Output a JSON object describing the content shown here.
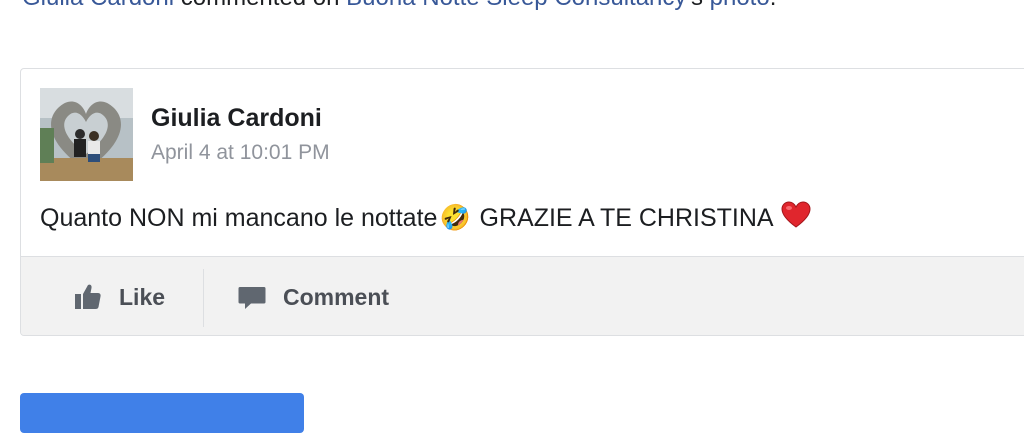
{
  "header": {
    "author_link": "Giulia Cardoni",
    "action_text": " commented on ",
    "page_link": "Buona Notte Sleep Consultancy",
    "possessive": "'s ",
    "photo_link": "photo",
    "period": "."
  },
  "comment": {
    "author": "Giulia Cardoni",
    "timestamp": "April 4 at 10:01 PM",
    "text_part1": "Quanto NON mi mancano le nottate",
    "emoji1": "🤣",
    "text_part2": " GRAZIE A TE CHRISTINA ",
    "emoji2": "❤️"
  },
  "actions": {
    "like_label": "Like",
    "comment_label": "Comment"
  },
  "colors": {
    "link": "#385898",
    "text": "#1c1e21",
    "muted": "#90949c",
    "action_bg": "#f2f2f2",
    "button_blue": "#4080e8"
  },
  "icons": {
    "like": "thumbs-up-icon",
    "comment": "speech-bubble-icon"
  }
}
